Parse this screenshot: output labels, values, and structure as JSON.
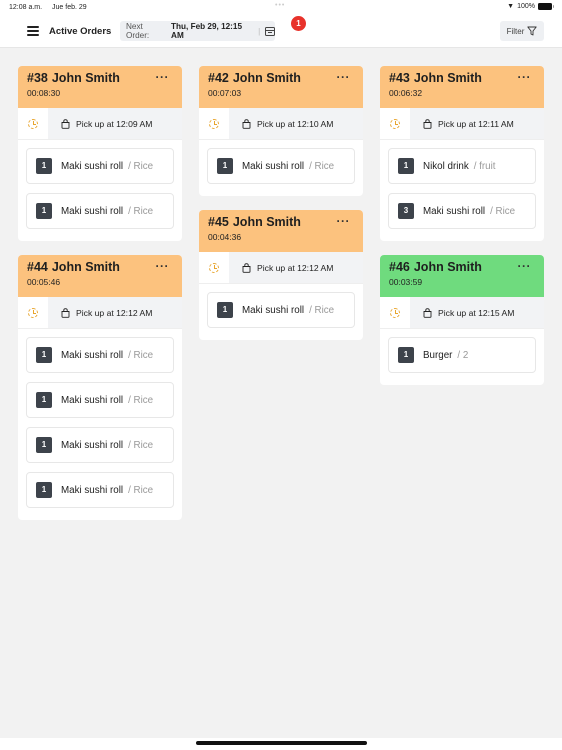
{
  "status_bar": {
    "time": "12:08 a.m.",
    "date": "Jue feb. 29",
    "battery": "100%"
  },
  "app_bar": {
    "title": "Active Orders",
    "next_order_label": "Next Order:",
    "next_order_value": "Thu, Feb 29, 12:15 AM",
    "notification_count": "1",
    "filter_label": "Filter"
  },
  "colors": {
    "pending": "#fcc27e",
    "ready": "#6fdb7e",
    "timer_icon": "#e8a52e",
    "badge": "#e8322b"
  },
  "orders": [
    {
      "id": "#38",
      "customer": "John Smith",
      "timer": "00:08:30",
      "status": "pending",
      "pickup": "Pick up at 12:09 AM",
      "items": [
        {
          "qty": "1",
          "name": "Maki sushi roll",
          "variant": "/ Rice"
        },
        {
          "qty": "1",
          "name": "Maki sushi roll",
          "variant": "/ Rice"
        }
      ]
    },
    {
      "id": "#42",
      "customer": "John Smith",
      "timer": "00:07:03",
      "status": "pending",
      "pickup": "Pick up at 12:10 AM",
      "items": [
        {
          "qty": "1",
          "name": "Maki sushi roll",
          "variant": "/ Rice"
        }
      ]
    },
    {
      "id": "#43",
      "customer": "John Smith",
      "timer": "00:06:32",
      "status": "pending",
      "pickup": "Pick up at 12:11 AM",
      "items": [
        {
          "qty": "1",
          "name": "Nikol drink",
          "variant": "/ fruit"
        },
        {
          "qty": "3",
          "name": "Maki sushi roll",
          "variant": "/ Rice"
        }
      ]
    },
    {
      "id": "#44",
      "customer": "John Smith",
      "timer": "00:05:46",
      "status": "pending",
      "pickup": "Pick up at 12:12 AM",
      "items": [
        {
          "qty": "1",
          "name": "Maki sushi roll",
          "variant": "/ Rice"
        },
        {
          "qty": "1",
          "name": "Maki sushi roll",
          "variant": "/ Rice"
        },
        {
          "qty": "1",
          "name": "Maki sushi roll",
          "variant": "/ Rice"
        },
        {
          "qty": "1",
          "name": "Maki sushi roll",
          "variant": "/ Rice"
        }
      ]
    },
    {
      "id": "#45",
      "customer": "John Smith",
      "timer": "00:04:36",
      "status": "pending",
      "pickup": "Pick up at 12:12 AM",
      "items": [
        {
          "qty": "1",
          "name": "Maki sushi roll",
          "variant": "/ Rice"
        }
      ]
    },
    {
      "id": "#46",
      "customer": "John Smith",
      "timer": "00:03:59",
      "status": "ready",
      "pickup": "Pick up at 12:15 AM",
      "items": [
        {
          "qty": "1",
          "name": "Burger",
          "variant": "/ 2"
        }
      ]
    }
  ]
}
